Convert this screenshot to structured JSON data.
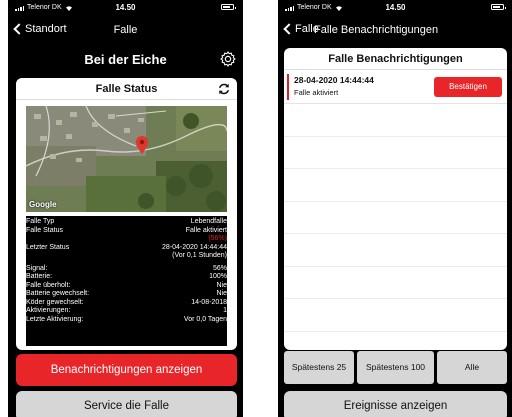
{
  "left": {
    "status": {
      "carrier": "Telenor DK",
      "time": "14.50"
    },
    "nav": {
      "back_label": "Standort",
      "title": "Falle"
    },
    "heading": "Bei der Eiche",
    "card_title": "Falle Status",
    "map": {
      "attribution": "Google"
    },
    "info": {
      "rows_top": [
        {
          "label": "Falle Typ",
          "value": "Lebendfalle"
        },
        {
          "label": "Falle Status",
          "value": "Falle aktiviert"
        }
      ],
      "status_percent": "(56%)",
      "last_status": {
        "label": "Letzter Status",
        "value": "28-04-2020 14:44:44",
        "sub": "(Vor 0,1 Stunden)"
      },
      "rows_bottom": [
        {
          "label": "Signal:",
          "value": "56%"
        },
        {
          "label": "Batterie:",
          "value": "100%"
        },
        {
          "label": "Falle überholt:",
          "value": "Nie"
        },
        {
          "label": "Batterie gewechselt:",
          "value": "Nie"
        },
        {
          "label": "Köder gewechselt:",
          "value": "14-08-2018"
        },
        {
          "label": "Aktivierungen:",
          "value": "1"
        },
        {
          "label": "Letzte Aktivierung:",
          "value": "Vor 0,0 Tagen"
        }
      ]
    },
    "buttons": {
      "notifications": "Benachrichtigungen anzeigen",
      "service": "Service die Falle"
    }
  },
  "right": {
    "status": {
      "carrier": "Telenor DK",
      "time": "14.50"
    },
    "nav": {
      "back_label": "Falle",
      "title": "Falle Benachrichtigungen"
    },
    "card_title": "Falle Benachrichtigungen",
    "notification": {
      "date": "28-04-2020 14:44:44",
      "text": "Falle aktiviert",
      "confirm_label": "Bestätigen"
    },
    "filters": [
      "Spätestens 25",
      "Spätestens 100",
      "Alle"
    ],
    "events_button": "Ereignisse anzeigen"
  },
  "colors": {
    "accent_red": "#e8262a",
    "grey_button": "#d6d6d6",
    "background": "#000000"
  },
  "icons": [
    "back-chevron-icon",
    "gear-icon",
    "refresh-icon",
    "map-pin-icon",
    "battery-icon",
    "signal-icon",
    "wifi-icon"
  ]
}
